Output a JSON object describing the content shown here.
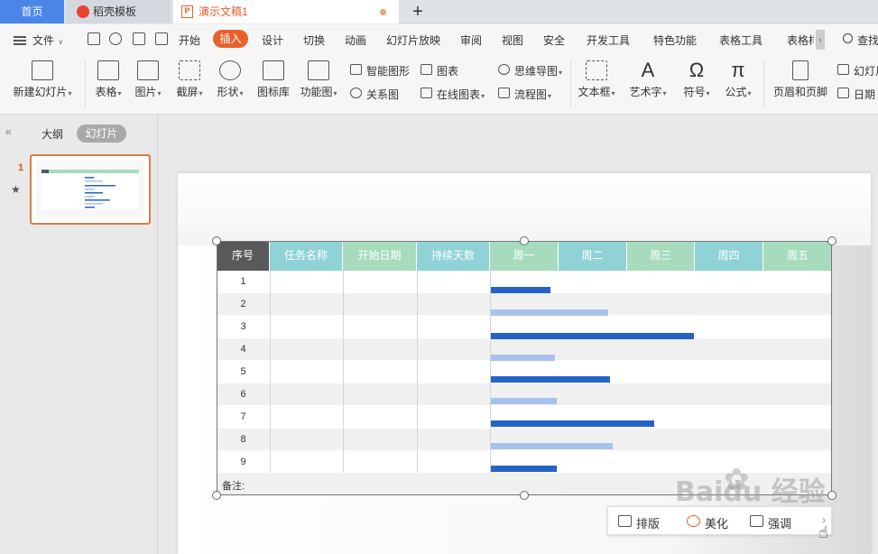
{
  "tabs": {
    "home": "首页",
    "template": "稻壳模板",
    "doc": "演示文稿1",
    "doc_icon": "P",
    "add": "+"
  },
  "menu": {
    "file": "文件",
    "items": [
      "开始",
      "插入",
      "设计",
      "切换",
      "动画",
      "幻灯片放映",
      "审阅",
      "视图",
      "安全",
      "开发工具",
      "特色功能",
      "表格工具",
      "表格样"
    ],
    "search": "查找"
  },
  "ribbon": {
    "new_slide": "新建幻灯片",
    "table": "表格",
    "image": "图片",
    "screenshot": "截屏",
    "shape": "形状",
    "icon_lib": "图标库",
    "func_chart": "功能图",
    "smart_shape": "智能图形",
    "chart": "图表",
    "relation": "关系图",
    "online_chart": "在线图表",
    "mindmap": "思维导图",
    "flowchart": "流程图",
    "textbox": "文本框",
    "art_text": "艺术字",
    "symbol": "符号",
    "formula": "公式",
    "header_footer": "页眉和页脚",
    "slide_num": "幻灯片",
    "date": "日期"
  },
  "leftpanel": {
    "collapse": "«",
    "outline": "大纲",
    "slides": "幻灯片",
    "slide_number": "1",
    "star": "★"
  },
  "gantt": {
    "headers": [
      "序号",
      "任务名称",
      "开始日期",
      "持续天数",
      "周一",
      "周二",
      "周三",
      "周四",
      "周五"
    ],
    "header_colors": [
      "#595959",
      "#8fd3d6",
      "#a6dcbd",
      "#8fd3d6",
      "#a6dcbd",
      "#8fd3d6",
      "#a6dcbd",
      "#8fd3d6",
      "#a6dcbd"
    ],
    "rows": [
      "1",
      "2",
      "3",
      "4",
      "5",
      "6",
      "7",
      "8",
      "9"
    ],
    "remark": "备注:",
    "bar_colors": {
      "dark": "#2563c8",
      "light": "#a9c2ec"
    }
  },
  "floatbar": {
    "layout": "排版",
    "beautify": "美化",
    "adjust": "强调",
    "more": "›"
  },
  "watermark": "Baidu 经验"
}
